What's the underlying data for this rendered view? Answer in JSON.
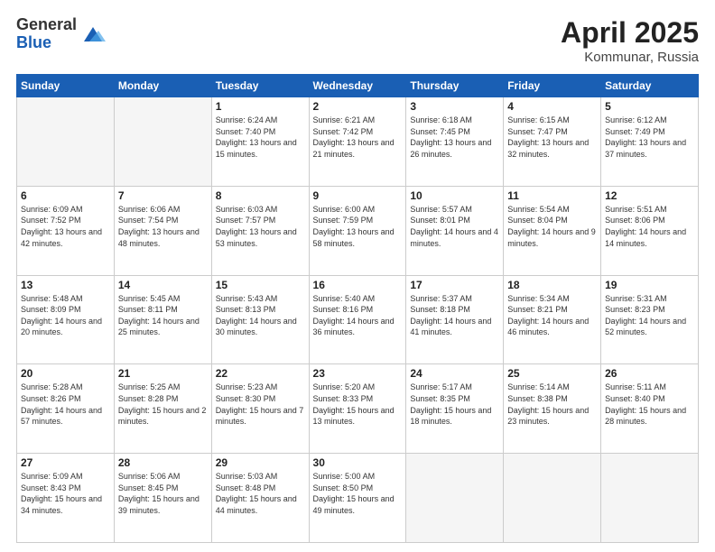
{
  "header": {
    "logo_general": "General",
    "logo_blue": "Blue",
    "title": "April 2025",
    "location": "Kommunar, Russia"
  },
  "days_of_week": [
    "Sunday",
    "Monday",
    "Tuesday",
    "Wednesday",
    "Thursday",
    "Friday",
    "Saturday"
  ],
  "weeks": [
    [
      {
        "day": "",
        "info": ""
      },
      {
        "day": "",
        "info": ""
      },
      {
        "day": "1",
        "info": "Sunrise: 6:24 AM\nSunset: 7:40 PM\nDaylight: 13 hours and 15 minutes."
      },
      {
        "day": "2",
        "info": "Sunrise: 6:21 AM\nSunset: 7:42 PM\nDaylight: 13 hours and 21 minutes."
      },
      {
        "day": "3",
        "info": "Sunrise: 6:18 AM\nSunset: 7:45 PM\nDaylight: 13 hours and 26 minutes."
      },
      {
        "day": "4",
        "info": "Sunrise: 6:15 AM\nSunset: 7:47 PM\nDaylight: 13 hours and 32 minutes."
      },
      {
        "day": "5",
        "info": "Sunrise: 6:12 AM\nSunset: 7:49 PM\nDaylight: 13 hours and 37 minutes."
      }
    ],
    [
      {
        "day": "6",
        "info": "Sunrise: 6:09 AM\nSunset: 7:52 PM\nDaylight: 13 hours and 42 minutes."
      },
      {
        "day": "7",
        "info": "Sunrise: 6:06 AM\nSunset: 7:54 PM\nDaylight: 13 hours and 48 minutes."
      },
      {
        "day": "8",
        "info": "Sunrise: 6:03 AM\nSunset: 7:57 PM\nDaylight: 13 hours and 53 minutes."
      },
      {
        "day": "9",
        "info": "Sunrise: 6:00 AM\nSunset: 7:59 PM\nDaylight: 13 hours and 58 minutes."
      },
      {
        "day": "10",
        "info": "Sunrise: 5:57 AM\nSunset: 8:01 PM\nDaylight: 14 hours and 4 minutes."
      },
      {
        "day": "11",
        "info": "Sunrise: 5:54 AM\nSunset: 8:04 PM\nDaylight: 14 hours and 9 minutes."
      },
      {
        "day": "12",
        "info": "Sunrise: 5:51 AM\nSunset: 8:06 PM\nDaylight: 14 hours and 14 minutes."
      }
    ],
    [
      {
        "day": "13",
        "info": "Sunrise: 5:48 AM\nSunset: 8:09 PM\nDaylight: 14 hours and 20 minutes."
      },
      {
        "day": "14",
        "info": "Sunrise: 5:45 AM\nSunset: 8:11 PM\nDaylight: 14 hours and 25 minutes."
      },
      {
        "day": "15",
        "info": "Sunrise: 5:43 AM\nSunset: 8:13 PM\nDaylight: 14 hours and 30 minutes."
      },
      {
        "day": "16",
        "info": "Sunrise: 5:40 AM\nSunset: 8:16 PM\nDaylight: 14 hours and 36 minutes."
      },
      {
        "day": "17",
        "info": "Sunrise: 5:37 AM\nSunset: 8:18 PM\nDaylight: 14 hours and 41 minutes."
      },
      {
        "day": "18",
        "info": "Sunrise: 5:34 AM\nSunset: 8:21 PM\nDaylight: 14 hours and 46 minutes."
      },
      {
        "day": "19",
        "info": "Sunrise: 5:31 AM\nSunset: 8:23 PM\nDaylight: 14 hours and 52 minutes."
      }
    ],
    [
      {
        "day": "20",
        "info": "Sunrise: 5:28 AM\nSunset: 8:26 PM\nDaylight: 14 hours and 57 minutes."
      },
      {
        "day": "21",
        "info": "Sunrise: 5:25 AM\nSunset: 8:28 PM\nDaylight: 15 hours and 2 minutes."
      },
      {
        "day": "22",
        "info": "Sunrise: 5:23 AM\nSunset: 8:30 PM\nDaylight: 15 hours and 7 minutes."
      },
      {
        "day": "23",
        "info": "Sunrise: 5:20 AM\nSunset: 8:33 PM\nDaylight: 15 hours and 13 minutes."
      },
      {
        "day": "24",
        "info": "Sunrise: 5:17 AM\nSunset: 8:35 PM\nDaylight: 15 hours and 18 minutes."
      },
      {
        "day": "25",
        "info": "Sunrise: 5:14 AM\nSunset: 8:38 PM\nDaylight: 15 hours and 23 minutes."
      },
      {
        "day": "26",
        "info": "Sunrise: 5:11 AM\nSunset: 8:40 PM\nDaylight: 15 hours and 28 minutes."
      }
    ],
    [
      {
        "day": "27",
        "info": "Sunrise: 5:09 AM\nSunset: 8:43 PM\nDaylight: 15 hours and 34 minutes."
      },
      {
        "day": "28",
        "info": "Sunrise: 5:06 AM\nSunset: 8:45 PM\nDaylight: 15 hours and 39 minutes."
      },
      {
        "day": "29",
        "info": "Sunrise: 5:03 AM\nSunset: 8:48 PM\nDaylight: 15 hours and 44 minutes."
      },
      {
        "day": "30",
        "info": "Sunrise: 5:00 AM\nSunset: 8:50 PM\nDaylight: 15 hours and 49 minutes."
      },
      {
        "day": "",
        "info": ""
      },
      {
        "day": "",
        "info": ""
      },
      {
        "day": "",
        "info": ""
      }
    ]
  ]
}
